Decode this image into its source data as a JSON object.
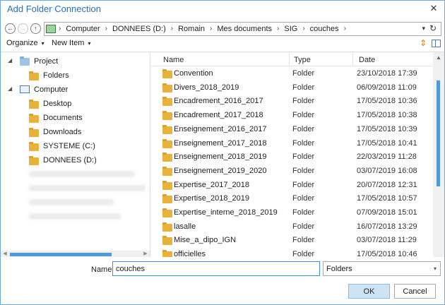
{
  "window": {
    "title": "Add Folder Connection",
    "close_glyph": "✕"
  },
  "address": {
    "back_glyph": "←",
    "forward_glyph": "→",
    "up_glyph": "↑",
    "crumbs": [
      "Computer",
      "DONNEES (D:)",
      "Romain",
      "Mes documents",
      "SIG",
      "couches"
    ],
    "separator": "›",
    "dropdown_glyph": "▾",
    "refresh_glyph": "↻"
  },
  "toolbar": {
    "organize_label": "Organize",
    "new_item_label": "New Item",
    "caret": "▾",
    "sort_glyph": "⇕"
  },
  "tree": {
    "expander_open": "◢",
    "project_label": "Project",
    "folders_label": "Folders",
    "computer_label": "Computer",
    "desktop_label": "Desktop",
    "documents_label": "Documents",
    "downloads_label": "Downloads",
    "system_label": "SYSTEME (C:)",
    "donnees_label": "DONNEES (D:)"
  },
  "list": {
    "headers": {
      "name": "Name",
      "type": "Type",
      "date": "Date"
    },
    "rows": [
      {
        "name": "Convention",
        "type": "Folder",
        "date": "23/10/2018 17:39"
      },
      {
        "name": "Divers_2018_2019",
        "type": "Folder",
        "date": "06/09/2018 11:09"
      },
      {
        "name": "Encadrement_2016_2017",
        "type": "Folder",
        "date": "17/05/2018 10:36"
      },
      {
        "name": "Encadrement_2017_2018",
        "type": "Folder",
        "date": "17/05/2018 10:38"
      },
      {
        "name": "Enseignement_2016_2017",
        "type": "Folder",
        "date": "17/05/2018 10:39"
      },
      {
        "name": "Enseignement_2017_2018",
        "type": "Folder",
        "date": "17/05/2018 10:41"
      },
      {
        "name": "Enseignement_2018_2019",
        "type": "Folder",
        "date": "22/03/2019 11:28"
      },
      {
        "name": "Enseignement_2019_2020",
        "type": "Folder",
        "date": "03/07/2019 16:08"
      },
      {
        "name": "Expertise_2017_2018",
        "type": "Folder",
        "date": "20/07/2018 12:31"
      },
      {
        "name": "Expertise_2018_2019",
        "type": "Folder",
        "date": "17/05/2018 10:57"
      },
      {
        "name": "Expertise_interne_2018_2019",
        "type": "Folder",
        "date": "07/09/2018 15:01"
      },
      {
        "name": "lasalle",
        "type": "Folder",
        "date": "16/07/2018 13:29"
      },
      {
        "name": "Mise_a_dipo_IGN",
        "type": "Folder",
        "date": "03/07/2018 11:29"
      },
      {
        "name": "officielles",
        "type": "Folder",
        "date": "17/05/2018 10:46"
      }
    ]
  },
  "footer": {
    "name_label": "Name",
    "name_value": "couches",
    "filter_value": "Folders",
    "filter_caret": "▾",
    "ok_label": "OK",
    "cancel_label": "Cancel"
  },
  "colors": {
    "accent": "#2a6ebb",
    "folder": "#e8b33a",
    "ok_fill": "#cde4f7",
    "scroll_thumb": "#4d9bdc"
  }
}
